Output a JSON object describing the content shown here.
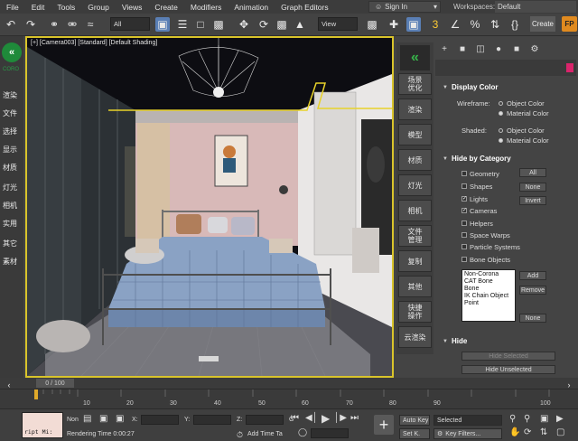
{
  "menu": [
    "File",
    "Edit",
    "Tools",
    "Group",
    "Views",
    "Create",
    "Modifiers",
    "Animation",
    "Graph Editors"
  ],
  "signin": "Sign In",
  "workspace": {
    "label": "Workspaces:",
    "value": "Default"
  },
  "toolbar": {
    "filter_value": "All",
    "view_value": "View",
    "create_label": "Create",
    "orange_label": "FP"
  },
  "left_panel": {
    "logo_text": "CORO",
    "items": [
      "渲染",
      "文件",
      "选择",
      "显示",
      "材质",
      "灯光",
      "相机",
      "实用",
      "其它",
      "素材"
    ]
  },
  "viewport": {
    "label": "[+] [Camera003] [Standard] [Default Shading]"
  },
  "tab_panel": {
    "items": [
      "场景\n优化",
      "渲染",
      "模型",
      "材质",
      "灯光",
      "相机",
      "文件\n管理",
      "复制",
      "其他",
      "快捷\n操作",
      "云渲染"
    ]
  },
  "command_panel": {
    "display_color": {
      "title": "Display Color",
      "wireframe_label": "Wireframe:",
      "shaded_label": "Shaded:",
      "object_color": "Object Color",
      "material_color": "Material Color"
    },
    "hide_by_category": {
      "title": "Hide by Category",
      "categories": [
        {
          "label": "Geometry",
          "checked": false
        },
        {
          "label": "Shapes",
          "checked": false
        },
        {
          "label": "Lights",
          "checked": true
        },
        {
          "label": "Cameras",
          "checked": true
        },
        {
          "label": "Helpers",
          "checked": false
        },
        {
          "label": "Space Warps",
          "checked": false
        },
        {
          "label": "Particle Systems",
          "checked": false
        },
        {
          "label": "Bone Objects",
          "checked": false
        }
      ],
      "all_btn": "All",
      "none_btn": "None",
      "invert_btn": "Invert",
      "list_items": [
        "Non-Corona",
        "CAT Bone",
        "Bone",
        "IK Chain Object",
        "Point"
      ],
      "add_btn": "Add",
      "remove_btn": "Remove",
      "none_btn2": "None"
    },
    "hide": {
      "title": "Hide",
      "hide_selected": "Hide Selected",
      "hide_unselected": "Hide Unselected"
    }
  },
  "timeline": {
    "slider": "0 / 100",
    "ticks": [
      "10",
      "20",
      "30",
      "40",
      "50",
      "60",
      "70",
      "80",
      "90",
      "100"
    ]
  },
  "status": {
    "script_text": "ript Mi:",
    "none_label": "Non",
    "x_label": "X:",
    "y_label": "Y:",
    "z_label": "Z:",
    "grid_label": "G",
    "rendering_time": "Rendering Time  0:00:27",
    "add_time_tag": "Add Time Ta",
    "auto_key": "Auto Key",
    "set_key": "Set K.",
    "selected": "Selected",
    "key_filters": "Key Filters..."
  },
  "colors": {
    "viewport_border": "#d9c42b",
    "accent_green": "#1f8a3a",
    "selection_blue": "#5a7fb5",
    "wire_yellow": "#e8d22a"
  }
}
